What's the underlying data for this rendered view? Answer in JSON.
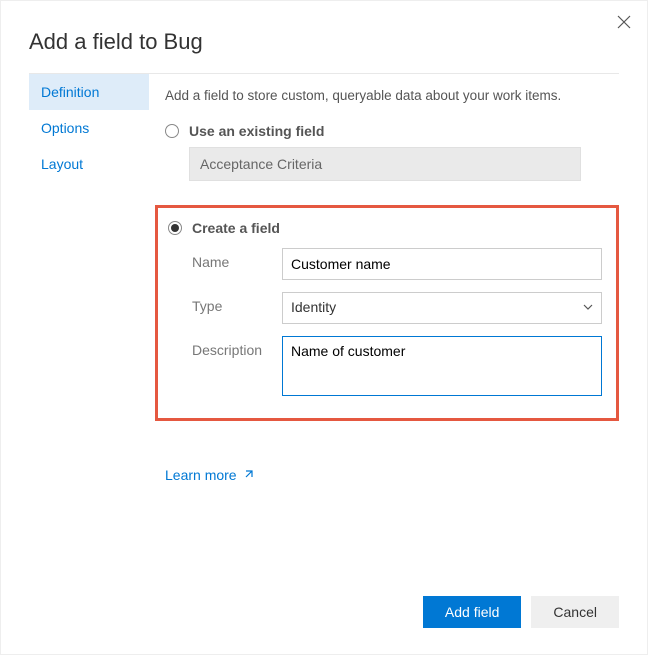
{
  "dialog": {
    "title": "Add a field to Bug",
    "intro": "Add a field to store custom, queryable data about your work items."
  },
  "sidebar": {
    "items": [
      {
        "label": "Definition",
        "active": true
      },
      {
        "label": "Options",
        "active": false
      },
      {
        "label": "Layout",
        "active": false
      }
    ]
  },
  "options": {
    "existing": {
      "label": "Use an existing field",
      "value": "Acceptance Criteria",
      "selected": false
    },
    "create": {
      "label": "Create a field",
      "selected": true,
      "name_label": "Name",
      "name_value": "Customer name",
      "type_label": "Type",
      "type_value": "Identity",
      "desc_label": "Description",
      "desc_value": "Name of customer"
    }
  },
  "learn_more": "Learn more",
  "footer": {
    "primary": "Add field",
    "secondary": "Cancel"
  }
}
